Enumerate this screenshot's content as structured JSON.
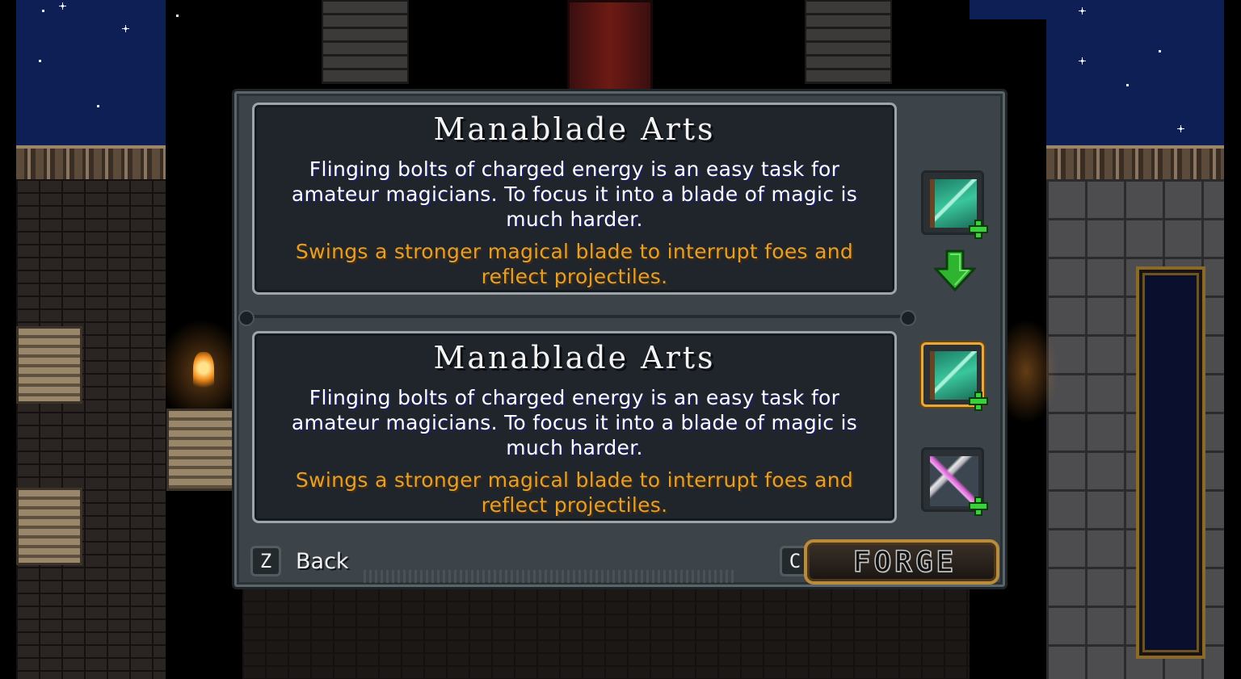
{
  "forge_dialog": {
    "current": {
      "title": "Manablade Arts",
      "description": "Flinging bolts of charged energy is an easy task for amateur magicians.  To focus it into a blade of magic is much harder.",
      "effect": "Swings a stronger magical blade to interrupt foes and reflect projectiles."
    },
    "result": {
      "title": "Manablade Arts",
      "description": "Flinging bolts of charged energy is an easy task for amateur magicians.  To focus it into a blade of magic is much harder.",
      "effect": "Swings a stronger magical blade to interrupt foes and reflect projectiles."
    },
    "slots": {
      "top_item_icon": "spell-tome-plus-icon",
      "transition_icon": "arrow-down-icon",
      "result_item_icon": "spell-tome-plus-icon",
      "material_icon": "magic-weapon-plus-icon"
    }
  },
  "controls": {
    "back_key": "Z",
    "back_label": "Back",
    "forge_key": "C",
    "forge_label": "FORGE"
  },
  "colors": {
    "description_text": "#ffffff",
    "effect_text": "#e2a02e",
    "selected_slot_border": "#e7a93a",
    "panel_bg": "#3c4449",
    "card_bg": "#1f252b"
  }
}
